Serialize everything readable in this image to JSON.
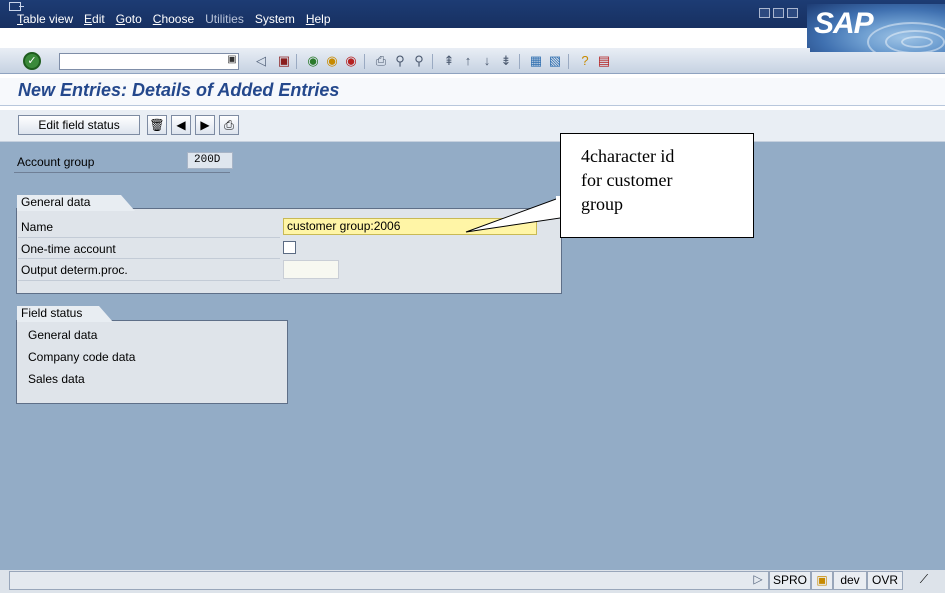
{
  "menubar": {
    "items": [
      {
        "label": "Table view",
        "accel": "T",
        "rest": "able view",
        "enabled": true
      },
      {
        "label": "Edit",
        "accel": "E",
        "rest": "dit",
        "enabled": true
      },
      {
        "label": "Goto",
        "accel": "G",
        "rest": "oto",
        "enabled": true
      },
      {
        "label": "Choose",
        "accel": "C",
        "rest": "hoose",
        "enabled": true
      },
      {
        "label": "Utilities",
        "accel": "",
        "rest": "Utilities",
        "enabled": false
      },
      {
        "label": "System",
        "accel": "",
        "rest": "System",
        "enabled": true
      },
      {
        "label": "Help",
        "accel": "H",
        "rest": "elp",
        "enabled": true
      }
    ],
    "logo": "SAP"
  },
  "toolbar": {
    "command_value": "",
    "icons": [
      "enter-icon",
      "save-icon",
      "back-icon",
      "exit-icon",
      "cancel-icon",
      "print-icon",
      "find-icon",
      "find-next-icon",
      "first-page-icon",
      "previous-page-icon",
      "next-page-icon",
      "last-page-icon",
      "create-session-icon",
      "shortcut-icon",
      "help-icon",
      "layout-icon"
    ]
  },
  "page": {
    "title": "New Entries: Details of Added Entries"
  },
  "app_toolbar": {
    "edit_field_status": "Edit field status"
  },
  "account": {
    "label": "Account group",
    "value": "200D"
  },
  "general_data": {
    "tab_label": "General data",
    "name_label": "Name",
    "name_value": "customer group:2006",
    "one_time_label": "One-time account",
    "one_time_checked": false,
    "output_label": "Output determ.proc.",
    "output_value": ""
  },
  "field_status": {
    "tab_label": "Field status",
    "items": [
      "General data",
      "Company code data",
      "Sales data"
    ]
  },
  "callout": {
    "lines": [
      "4character id",
      "for customer",
      "group"
    ]
  },
  "statusbar": {
    "system": "SPRO",
    "client": "dev",
    "mode": "OVR"
  },
  "colors": {
    "menubar": "#1d3c74",
    "background": "#93acc6",
    "title": "#24488c",
    "input_highlight": "#fff5a6"
  }
}
